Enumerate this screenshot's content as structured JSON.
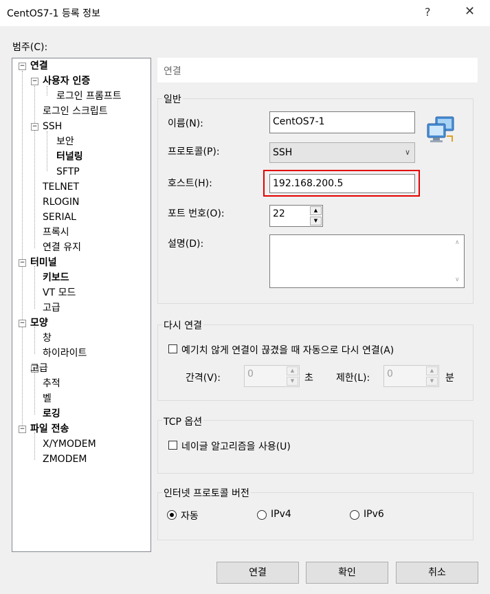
{
  "window": {
    "title": "CentOS7-1 등록 정보",
    "help_glyph": "?",
    "close_glyph": "✕"
  },
  "category_label": "범주(C):",
  "tree": [
    {
      "label": "연결",
      "bold": true
    },
    {
      "label": "사용자 인증",
      "bold": true
    },
    {
      "label": "로그인 프롬프트",
      "bold": false
    },
    {
      "label": "로그인 스크립트",
      "bold": false
    },
    {
      "label": "SSH",
      "bold": false
    },
    {
      "label": "보안",
      "bold": false
    },
    {
      "label": "터널링",
      "bold": true
    },
    {
      "label": "SFTP",
      "bold": false
    },
    {
      "label": "TELNET",
      "bold": false
    },
    {
      "label": "RLOGIN",
      "bold": false
    },
    {
      "label": "SERIAL",
      "bold": false
    },
    {
      "label": "프록시",
      "bold": false
    },
    {
      "label": "연결 유지",
      "bold": false
    },
    {
      "label": "터미널",
      "bold": true
    },
    {
      "label": "키보드",
      "bold": true
    },
    {
      "label": "VT 모드",
      "bold": false
    },
    {
      "label": "고급",
      "bold": false
    },
    {
      "label": "모양",
      "bold": true
    },
    {
      "label": "창",
      "bold": false
    },
    {
      "label": "하이라이트",
      "bold": false
    },
    {
      "label": "고급",
      "bold": false
    },
    {
      "label": "추적",
      "bold": false
    },
    {
      "label": "벨",
      "bold": false
    },
    {
      "label": "로깅",
      "bold": true
    },
    {
      "label": "파일 전송",
      "bold": true
    },
    {
      "label": "X/YMODEM",
      "bold": false
    },
    {
      "label": "ZMODEM",
      "bold": false
    }
  ],
  "panel": {
    "header": "연결",
    "general": {
      "title": "일반",
      "name_label": "이름(N):",
      "name_value": "CentOS7-1",
      "protocol_label": "프로토콜(P):",
      "protocol_value": "SSH",
      "host_label": "호스트(H):",
      "host_value": "192.168.200.5",
      "port_label": "포트 번호(O):",
      "port_value": "22",
      "desc_label": "설명(D):",
      "desc_value": ""
    },
    "reconnect": {
      "title": "다시 연결",
      "checkbox_label": "예기치 않게 연결이 끊겼을 때 자동으로 다시 연결(A)",
      "checked": false,
      "interval_label": "간격(V):",
      "interval_value": "0",
      "interval_unit": "초",
      "limit_label": "제한(L):",
      "limit_value": "0",
      "limit_unit": "분"
    },
    "tcp": {
      "title": "TCP 옵션",
      "nagle_label": "네이글 알고리즘을 사용(U)",
      "checked": false
    },
    "ip": {
      "title": "인터넷 프로토콜 버전",
      "options": [
        "자동",
        "IPv4",
        "IPv6"
      ],
      "selected": "자동"
    }
  },
  "buttons": {
    "connect": "연결",
    "ok": "확인",
    "cancel": "취소"
  },
  "colors": {
    "highlight_border": "#e30000",
    "window_bg": "#f0f0f0"
  },
  "icons": {
    "computers": "network-computers-icon"
  }
}
